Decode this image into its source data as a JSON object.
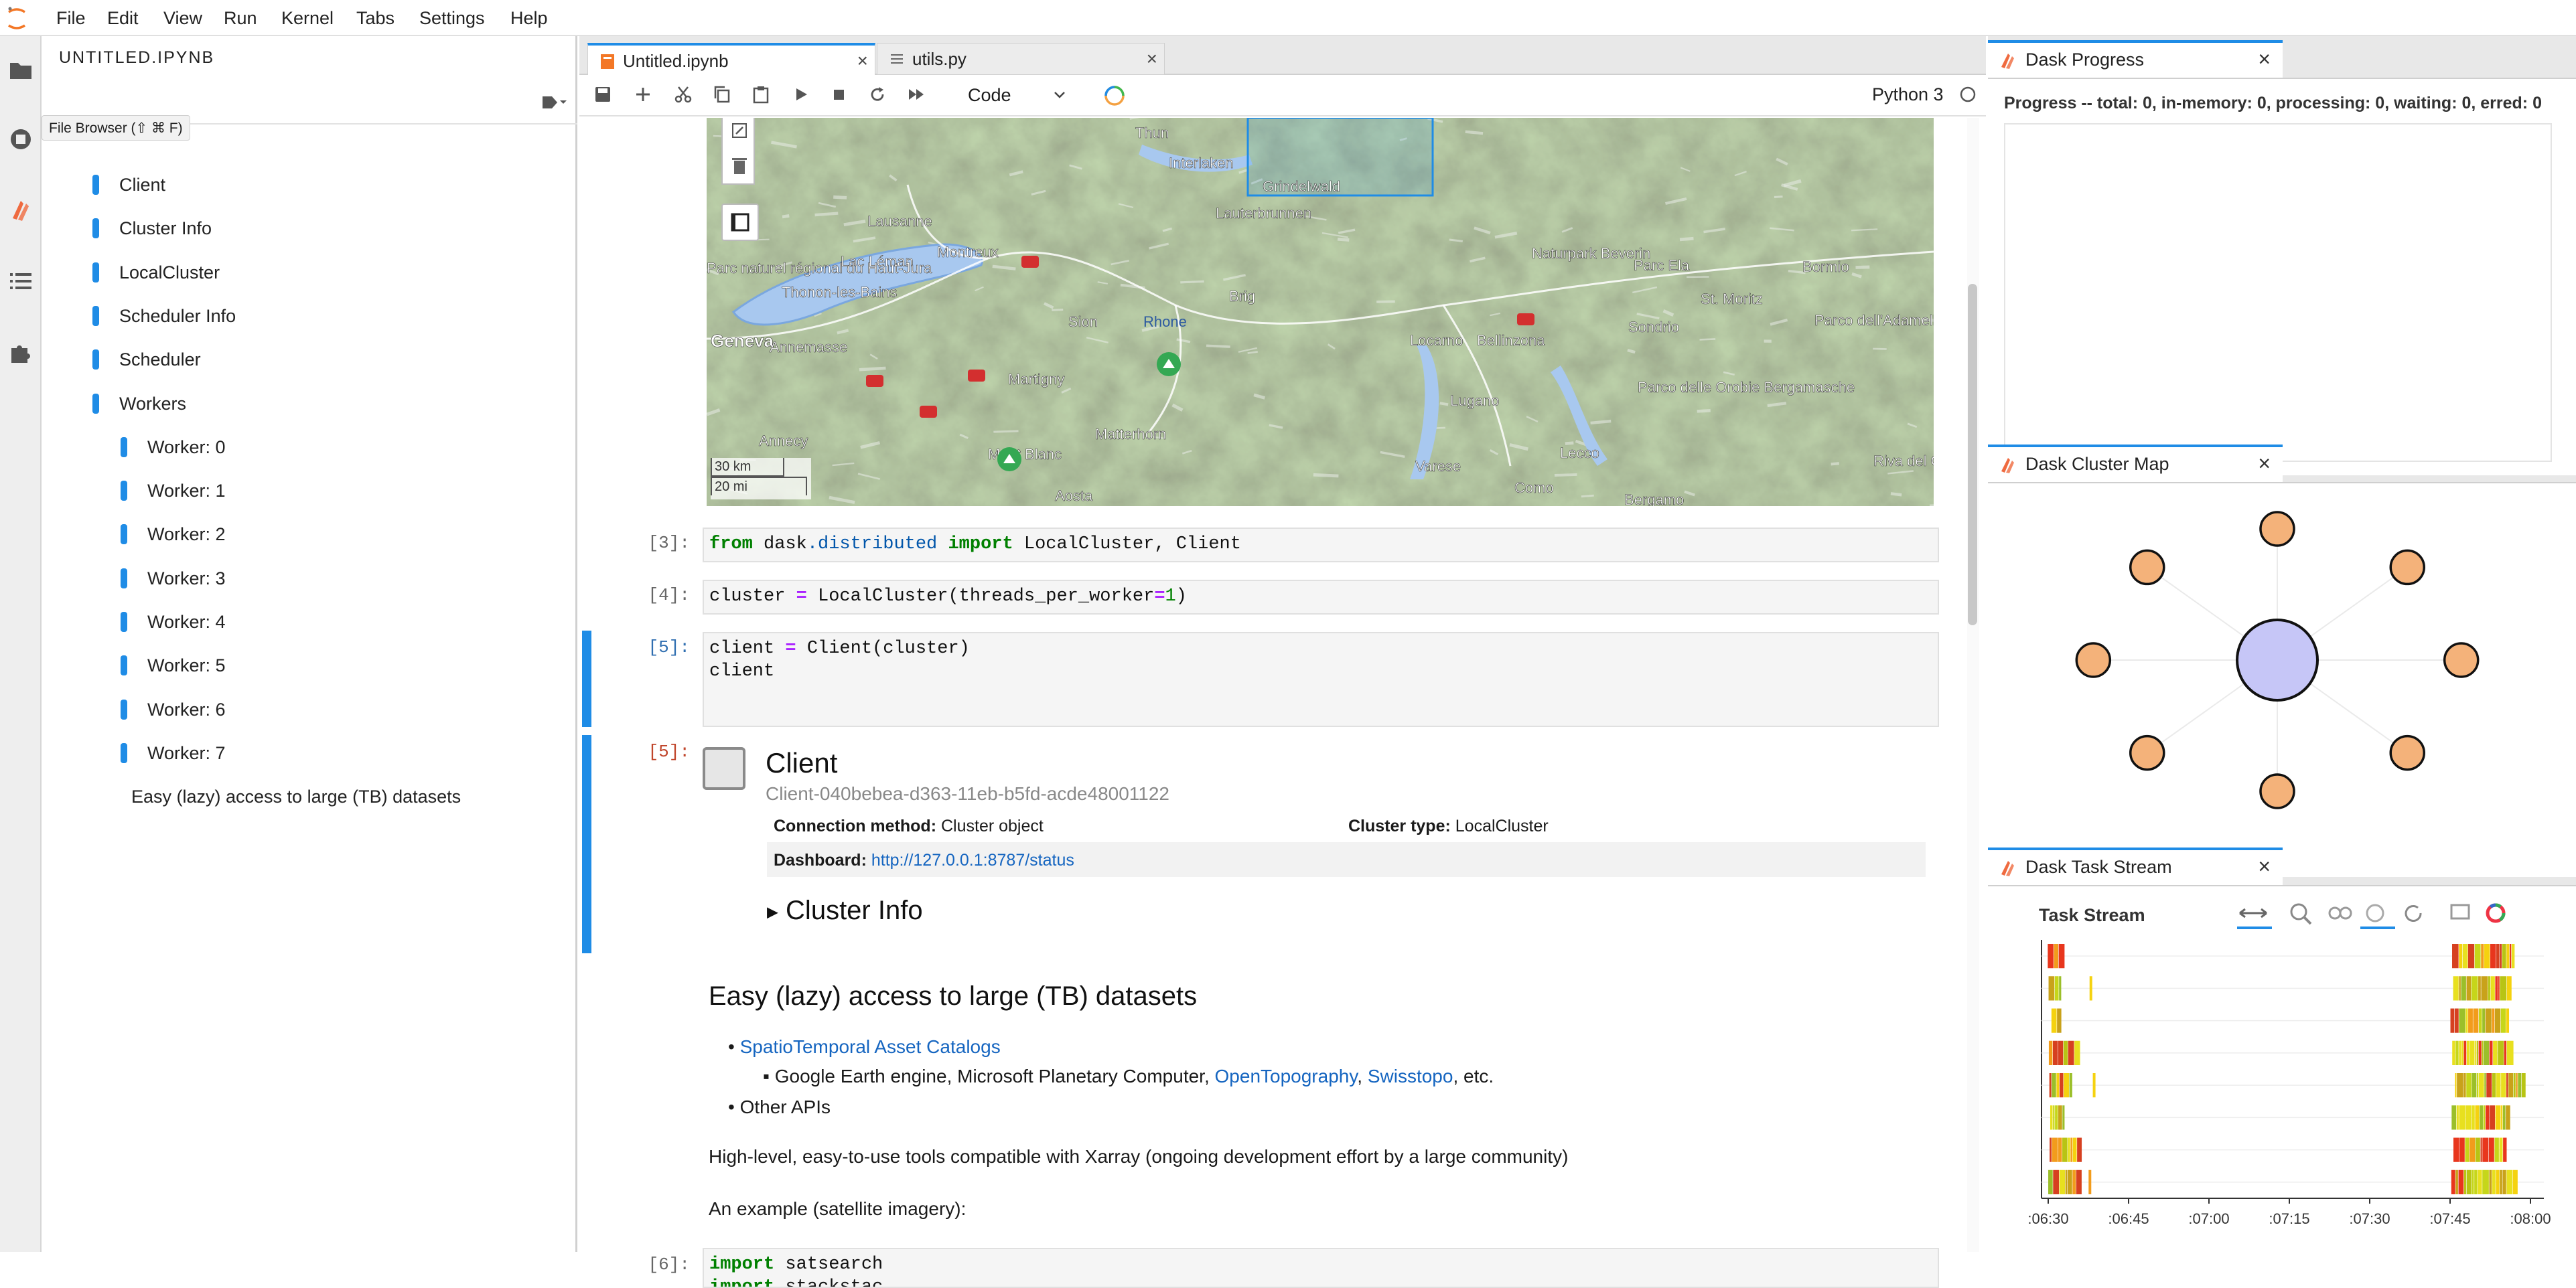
{
  "menubar": {
    "items": [
      "File",
      "Edit",
      "View",
      "Run",
      "Kernel",
      "Tabs",
      "Settings",
      "Help"
    ]
  },
  "sidepanel": {
    "title": "UNTITLED.IPYNB",
    "tooltip": "File Browser (⇧ ⌘ F)",
    "toc": [
      {
        "label": "Client",
        "level": 1
      },
      {
        "label": "Cluster Info",
        "level": 1
      },
      {
        "label": "LocalCluster",
        "level": 1
      },
      {
        "label": "Scheduler Info",
        "level": 1
      },
      {
        "label": "Scheduler",
        "level": 1
      },
      {
        "label": "Workers",
        "level": 1
      },
      {
        "label": "Worker: 0",
        "level": 2
      },
      {
        "label": "Worker: 1",
        "level": 2
      },
      {
        "label": "Worker: 2",
        "level": 2
      },
      {
        "label": "Worker: 3",
        "level": 2
      },
      {
        "label": "Worker: 4",
        "level": 2
      },
      {
        "label": "Worker: 5",
        "level": 2
      },
      {
        "label": "Worker: 6",
        "level": 2
      },
      {
        "label": "Worker: 7",
        "level": 2
      },
      {
        "label": "Easy (lazy) access to large (TB) datasets",
        "level": 0
      }
    ]
  },
  "tabs": [
    {
      "label": "Untitled.ipynb",
      "active": true
    },
    {
      "label": "utils.py",
      "active": false
    }
  ],
  "toolbar": {
    "cell_type": "Code",
    "kernel": "Python 3"
  },
  "map": {
    "scale_km": "30 km",
    "scale_mi": "20 mi",
    "places": [
      "Thun",
      "Interlaken",
      "Lausanne",
      "Montreux",
      "Lac Léman",
      "Parc naturel régional du Haut-Jura",
      "Thonon-les-Bains",
      "Geneva",
      "Annemasse",
      "Annecy",
      "Martigny",
      "Sion",
      "Brig",
      "Matterhorn",
      "Mont Blanc",
      "Aosta",
      "Locarno",
      "Bellinzona",
      "Lugano",
      "Varese",
      "Como",
      "Lecco",
      "Sondrio",
      "Bormio",
      "Parco dell'Adamello",
      "Parco delle Orobie Bergamasche",
      "Naturpark Beverin",
      "Parc Ela",
      "St. Moritz",
      "Riva del Garda",
      "Bergamo",
      "Lauterbrunnen",
      "Grindelwald",
      "Rhone"
    ]
  },
  "cells": {
    "c3_prompt": "[3]:",
    "c3_code": [
      "from",
      " dask",
      ".distributed",
      " import",
      " LocalCluster, Client"
    ],
    "c4_prompt": "[4]:",
    "c4_code": [
      "cluster ",
      "=",
      " LocalCluster(threads_per_worker",
      "=",
      "1",
      ")"
    ],
    "c5_prompt": "[5]:",
    "c5_line1": [
      "client ",
      "=",
      " Client(cluster)"
    ],
    "c5_line2": "client",
    "out5_prompt": "[5]:",
    "c6_prompt": "[6]:",
    "c6_line1": [
      "import",
      " satsearch"
    ],
    "c6_line2": [
      "import",
      " stackstac"
    ]
  },
  "client_output": {
    "title": "Client",
    "id": "Client-040bebea-d363-11eb-b5fd-acde48001122",
    "conn_label": "Connection method:",
    "conn_value": "Cluster object",
    "type_label": "Cluster type:",
    "type_value": "LocalCluster",
    "dash_label": "Dashboard:",
    "dash_value": "http://127.0.0.1:8787/status",
    "cluster_info": "Cluster Info"
  },
  "markdown": {
    "heading": "Easy (lazy) access to large (TB) datasets",
    "bullet1": "SpatioTemporal Asset Catalogs",
    "sub_prefix": "Google Earth engine, Microsoft Planetary Computer, ",
    "sub_link1": "OpenTopography",
    "sub_sep": ", ",
    "sub_link2": "Swisstopo",
    "sub_suffix": ", etc.",
    "bullet2": "Other APIs",
    "para1": "High-level, easy-to-use tools compatible with Xarray (ongoing development effort by a large community)",
    "para2": "An example (satellite imagery):"
  },
  "dask_progress": {
    "title": "Dask Progress",
    "text": "Progress -- total: 0, in-memory: 0, processing: 0, waiting: 0, erred: 0"
  },
  "dask_cluster_map": {
    "title": "Dask Cluster Map",
    "workers": 8
  },
  "dask_task_stream": {
    "title": "Dask Task Stream",
    "chart_title": "Task Stream",
    "x_ticks": [
      ":06:30",
      ":06:45",
      ":07:00",
      ":07:15",
      ":07:30",
      ":07:45",
      ":08:00"
    ],
    "rows": 8
  },
  "colors": {
    "accent": "#1f8ce6",
    "worker_node": "#f4b27a",
    "scheduler_node": "#c6c6f7"
  }
}
